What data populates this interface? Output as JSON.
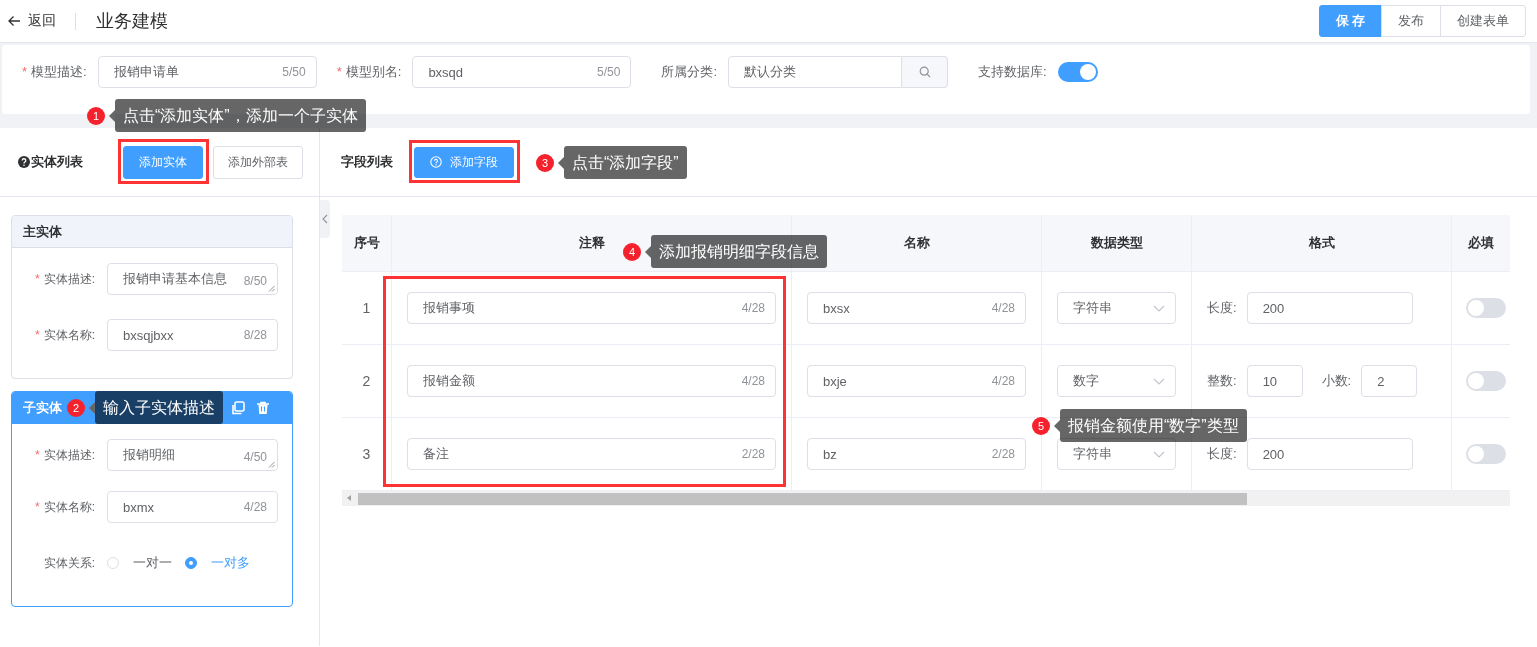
{
  "header": {
    "back_label": "返回",
    "title": "业务建模",
    "buttons": [
      {
        "label": "保存",
        "primary": true
      },
      {
        "label": "发布",
        "primary": false
      },
      {
        "label": "创建表单",
        "primary": false
      }
    ]
  },
  "model_form": {
    "fields": [
      {
        "kind": "text",
        "label": "模型描述:",
        "required_mark": "*",
        "value": "报销申请单",
        "count": "5/50"
      },
      {
        "kind": "text",
        "label": "模型别名:",
        "required_mark": "*",
        "value": "bxsqd",
        "count": "5/50"
      },
      {
        "kind": "search",
        "label": "所属分类:",
        "value": "默认分类"
      },
      {
        "kind": "switch",
        "label": "支持数据库:",
        "on": true
      }
    ]
  },
  "entity_panel": {
    "title": "实体列表",
    "buttons": [
      {
        "label": "添加实体",
        "primary": true,
        "highlighted": true
      },
      {
        "label": "添加外部表",
        "primary": false,
        "highlighted": false
      }
    ],
    "entities": [
      {
        "title": "主实体",
        "selected": false,
        "fields": [
          {
            "kind": "textarea",
            "label": "实体描述:",
            "required_mark": "*",
            "value": "报销申请基本信息",
            "count": "8/50"
          },
          {
            "kind": "text",
            "label": "实体名称:",
            "required_mark": "*",
            "value": "bxsqjbxx",
            "count": "8/28"
          }
        ]
      },
      {
        "title": "子实体",
        "selected": true,
        "fields": [
          {
            "kind": "textarea",
            "label": "实体描述:",
            "required_mark": "*",
            "value": "报销明细",
            "count": "4/50"
          },
          {
            "kind": "text",
            "label": "实体名称:",
            "required_mark": "*",
            "value": "bxmx",
            "count": "4/28"
          },
          {
            "kind": "radio",
            "label": "实体关系:",
            "options": [
              {
                "label": "一对一",
                "selected": false
              },
              {
                "label": "一对多",
                "selected": true
              }
            ]
          }
        ]
      }
    ]
  },
  "field_panel": {
    "title": "字段列表",
    "add_button": {
      "label": "添加字段",
      "highlighted": true
    },
    "table": {
      "columns": [
        {
          "label": "序号",
          "highlighted": false
        },
        {
          "label": "注释",
          "highlighted": true
        },
        {
          "label": "名称",
          "highlighted": false
        },
        {
          "label": "数据类型",
          "highlighted": false
        },
        {
          "label": "格式",
          "highlighted": false
        },
        {
          "label": "必填",
          "highlighted": false
        }
      ],
      "rows": [
        {
          "index": "1",
          "comment": {
            "value": "报销事项",
            "count": "4/28"
          },
          "name": {
            "value": "bxsx",
            "count": "4/28"
          },
          "data_type": "字符串",
          "format": [
            {
              "label": "长度:",
              "value": "200",
              "kind": "wide"
            }
          ],
          "required": false
        },
        {
          "index": "2",
          "comment": {
            "value": "报销金额",
            "count": "4/28"
          },
          "name": {
            "value": "bxje",
            "count": "4/28"
          },
          "data_type": "数字",
          "format": [
            {
              "label": "整数:",
              "value": "10",
              "kind": "narrow"
            },
            {
              "label": "小数:",
              "value": "2",
              "kind": "narrow"
            }
          ],
          "required": false
        },
        {
          "index": "3",
          "comment": {
            "value": "备注",
            "count": "2/28"
          },
          "name": {
            "value": "bz",
            "count": "2/28"
          },
          "data_type": "字符串",
          "format": [
            {
              "label": "长度:",
              "value": "200",
              "kind": "wide"
            }
          ],
          "required": false
        }
      ]
    }
  },
  "annotations": [
    {
      "number": "1",
      "text": "点击“添加实体”，添加一个子实体"
    },
    {
      "number": "2",
      "text": "输入子实体描述"
    },
    {
      "number": "3",
      "text": "点击“添加字段”"
    },
    {
      "number": "4",
      "text": "添加报销明细字段信息"
    },
    {
      "number": "5",
      "text": "报销金额使用“数字”类型"
    }
  ]
}
